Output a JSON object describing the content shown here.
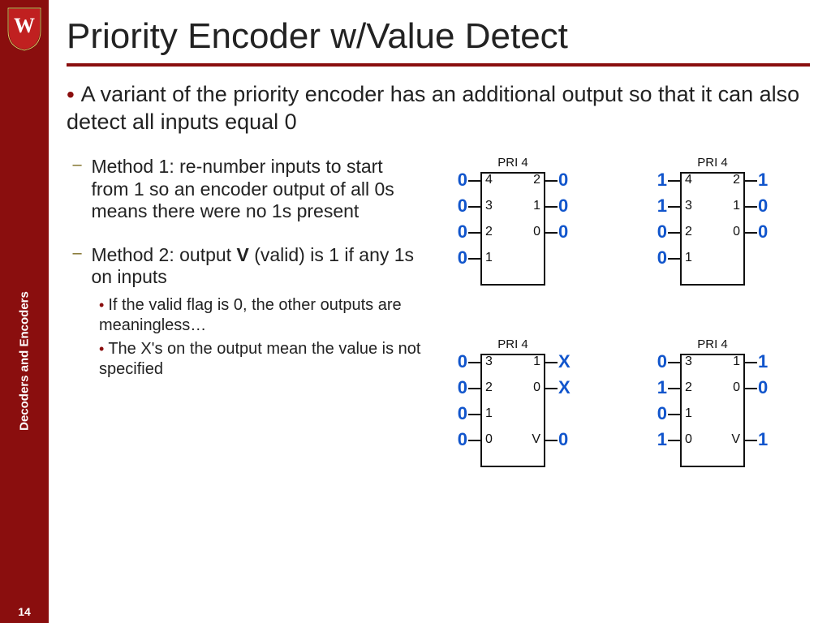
{
  "sidebar": {
    "section_title": "Decoders and Encoders",
    "page_number": "14"
  },
  "title": "Priority Encoder w/Value Detect",
  "bullets": {
    "top": "A variant of the priority encoder has an additional output so that it can also detect all inputs equal 0",
    "sub1": "Method 1: re-number inputs to start from 1 so an encoder output of all 0s means there were no 1s present",
    "sub2_pre": "Method 2: output ",
    "sub2_bold": "V",
    "sub2_post": " (valid) is 1 if any 1s on inputs",
    "subsub1": "If the valid flag is 0, the other outputs are meaningless…",
    "subsub2": "The X's on the output mean the value is not specified"
  },
  "block_label": "PRI 4",
  "blocks": [
    {
      "left_pins": [
        "4",
        "3",
        "2",
        "1"
      ],
      "right_pins": [
        "2",
        "1",
        "0"
      ],
      "left_vals": [
        "0",
        "0",
        "0",
        "0"
      ],
      "right_vals": [
        "0",
        "0",
        "0"
      ]
    },
    {
      "left_pins": [
        "4",
        "3",
        "2",
        "1"
      ],
      "right_pins": [
        "2",
        "1",
        "0"
      ],
      "left_vals": [
        "1",
        "1",
        "0",
        "0"
      ],
      "right_vals": [
        "1",
        "0",
        "0"
      ]
    },
    {
      "left_pins": [
        "3",
        "2",
        "1",
        "0"
      ],
      "right_pins": [
        "1",
        "0",
        "",
        "V"
      ],
      "left_vals": [
        "0",
        "0",
        "0",
        "0"
      ],
      "right_vals": [
        "X",
        "X",
        "",
        "0"
      ]
    },
    {
      "left_pins": [
        "3",
        "2",
        "1",
        "0"
      ],
      "right_pins": [
        "1",
        "0",
        "",
        "V"
      ],
      "left_vals": [
        "0",
        "1",
        "0",
        "1"
      ],
      "right_vals": [
        "1",
        "0",
        "",
        "1"
      ]
    }
  ]
}
